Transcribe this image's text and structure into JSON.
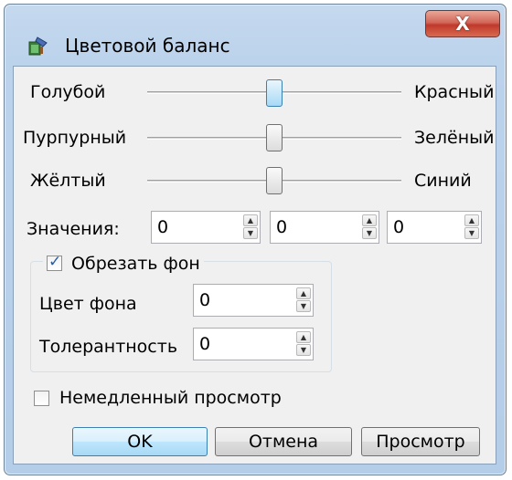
{
  "window": {
    "title": "Цветовой баланс",
    "close_label": "X"
  },
  "sliders": [
    {
      "left_label": "Голубой",
      "right_label": "Красный",
      "value": 0.5,
      "active": true
    },
    {
      "left_label": "Пурпурный",
      "right_label": "Зелёный",
      "value": 0.5,
      "active": false
    },
    {
      "left_label": "Жёлтый",
      "right_label": "Синий",
      "value": 0.5,
      "active": false
    }
  ],
  "values": {
    "label": "Значения:",
    "fields": [
      "0",
      "0",
      "0"
    ]
  },
  "crop_background": {
    "checkbox_label": "Обрезать фон",
    "checked": true,
    "bg_color_label": "Цвет фона",
    "bg_color_value": "0",
    "tolerance_label": "Толерантность",
    "tolerance_value": "0"
  },
  "instant_preview": {
    "label": "Немедленный просмотр",
    "checked": false
  },
  "buttons": {
    "ok": "OK",
    "cancel": "Отмена",
    "preview": "Просмотр"
  },
  "colors": {
    "accent": "#3c7fb1",
    "close_red": "#c0392b",
    "frame": "#b9d1ea"
  }
}
